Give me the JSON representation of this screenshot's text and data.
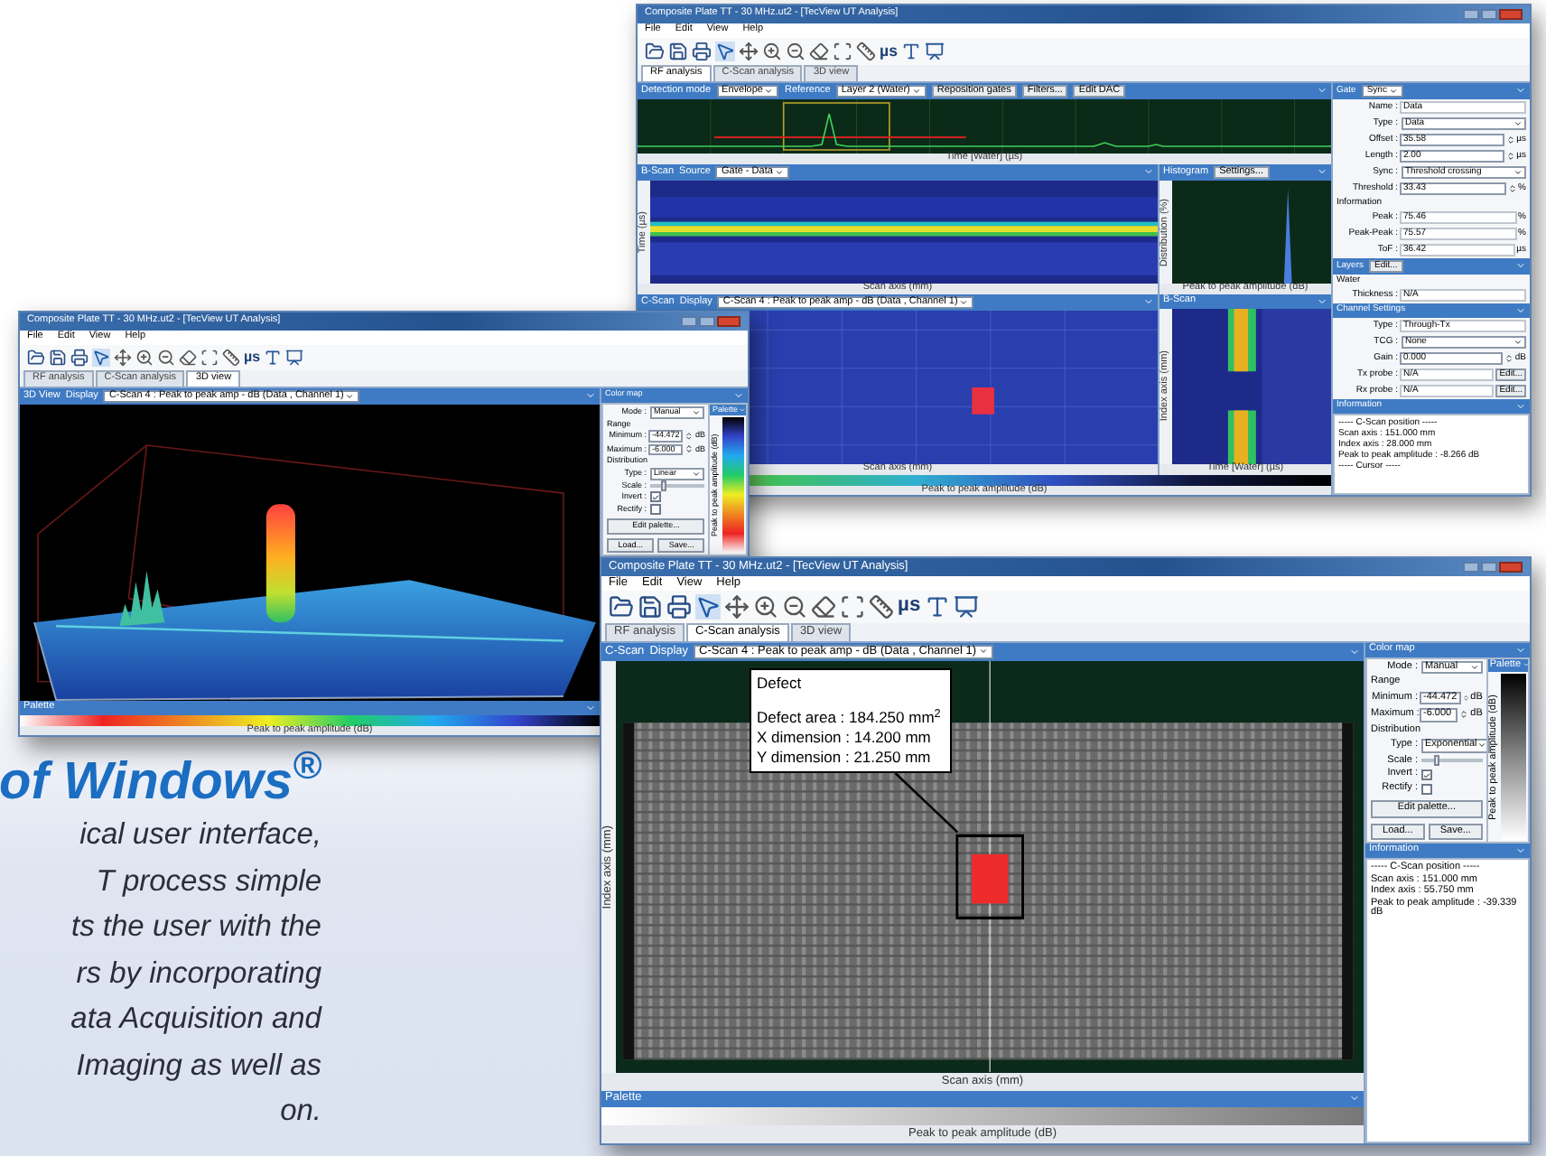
{
  "banner": {
    "heading": "of Windows$^{®}$",
    "lines": [
      "ical user interface,",
      "T process simple",
      "ts the user with the",
      "rs by incorporating",
      "ata Acquisition and",
      "Imaging as well as",
      "on."
    ]
  },
  "window_top": {
    "title": "Composite Plate TT - 30 MHz.ut2 - [TecView UT Analysis]",
    "menu": [
      "File",
      "Edit",
      "View",
      "Help"
    ],
    "toolbar_units": "µs",
    "tabs": [
      {
        "label": "RF analysis",
        "selected": true
      },
      {
        "label": "C-Scan analysis",
        "selected": false
      },
      {
        "label": "3D view",
        "selected": false
      }
    ],
    "ascan": {
      "header": [
        {
          "kind": "label",
          "text": "Detection mode"
        },
        {
          "kind": "select",
          "text": "Envelope"
        },
        {
          "kind": "label",
          "text": "Reference"
        },
        {
          "kind": "select",
          "text": "Layer 2 (Water)"
        },
        {
          "kind": "button",
          "text": "Reposition gates"
        },
        {
          "kind": "button",
          "text": "Filters..."
        },
        {
          "kind": "button",
          "text": "Edit DAC"
        }
      ],
      "xlabel": "Time [Water] (µs)"
    },
    "bscan": {
      "header": [
        {
          "kind": "label",
          "text": "B-Scan"
        },
        {
          "kind": "label",
          "text": "Source"
        },
        {
          "kind": "select",
          "text": "Gate - Data"
        }
      ],
      "xlabel": "Scan axis (mm)",
      "ylabel": "Time (µs)"
    },
    "histogram": {
      "header": [
        {
          "kind": "label",
          "text": "Histogram"
        },
        {
          "kind": "button",
          "text": "Settings..."
        }
      ],
      "xlabel": "Peak to peak amplitude (dB)",
      "ylabel": "Distribution (%)"
    },
    "cscan": {
      "header": [
        {
          "kind": "label",
          "text": "C-Scan"
        },
        {
          "kind": "label",
          "text": "Display"
        },
        {
          "kind": "select",
          "text": "C-Scan 4 : Peak to peak amp - dB (Data , Channel 1)"
        }
      ],
      "xlabel": "Scan axis (mm)"
    },
    "bscan2": {
      "header": [
        {
          "kind": "label",
          "text": "B-Scan"
        }
      ],
      "xlabel": "Time [Water] (µs)",
      "ylabel": "Index axis (mm)"
    },
    "palette": {
      "xlabel": "Peak to peak amplitude (dB)"
    },
    "gate": {
      "header": [
        {
          "kind": "label",
          "text": "Gate"
        },
        {
          "kind": "select",
          "text": "Sync"
        }
      ],
      "fields": [
        {
          "kind": "value",
          "label": "Name :",
          "value": "Data"
        },
        {
          "kind": "select",
          "label": "Type :",
          "value": "Data"
        },
        {
          "kind": "spin",
          "label": "Offset :",
          "value": "35.58",
          "unit": "µs"
        },
        {
          "kind": "spin",
          "label": "Length :",
          "value": "2.00",
          "unit": "µs"
        },
        {
          "kind": "select",
          "label": "Sync :",
          "value": "Threshold crossing"
        },
        {
          "kind": "spin",
          "label": "Threshold :",
          "value": "33.43",
          "unit": "%"
        },
        {
          "kind": "heading",
          "label": "Information"
        },
        {
          "kind": "value",
          "label": "Peak :",
          "value": "75.46",
          "unit": "%"
        },
        {
          "kind": "value",
          "label": "Peak-Peak :",
          "value": "75.57",
          "unit": "%"
        },
        {
          "kind": "value",
          "label": "ToF :",
          "value": "36.42",
          "unit": "µs"
        }
      ]
    },
    "layers": {
      "header": [
        {
          "kind": "label",
          "text": "Layers"
        },
        {
          "kind": "button",
          "text": "Edit..."
        }
      ],
      "fields": [
        {
          "kind": "heading",
          "label": "Water"
        },
        {
          "kind": "value",
          "label": "Thickness :",
          "value": "N/A"
        }
      ]
    },
    "channel": {
      "header": [
        {
          "kind": "label",
          "text": "Channel Settings"
        }
      ],
      "fields": [
        {
          "kind": "value",
          "label": "Type :",
          "value": "Through-Tx"
        },
        {
          "kind": "select",
          "label": "TCG :",
          "value": "None"
        },
        {
          "kind": "spin",
          "label": "Gain :",
          "value": "0.000",
          "unit": "dB"
        },
        {
          "kind": "edit",
          "label": "Tx probe :",
          "value": "N/A",
          "button": "Edit..."
        },
        {
          "kind": "edit",
          "label": "Rx probe :",
          "value": "N/A",
          "button": "Edit..."
        }
      ]
    },
    "information": {
      "title": "Information",
      "lines": [
        "----- C-Scan position -----",
        "Scan axis : 151.000 mm",
        "Index axis : 28.000 mm",
        "Peak to peak amplitude : -8.266 dB",
        "----- Cursor -----"
      ]
    }
  },
  "window_3d": {
    "title": "Composite Plate TT - 30 MHz.ut2 - [TecView UT Analysis]",
    "menu": [
      "File",
      "Edit",
      "View",
      "Help"
    ],
    "toolbar_units": "µs",
    "tabs": [
      {
        "label": "RF analysis",
        "selected": false
      },
      {
        "label": "C-Scan analysis",
        "selected": false
      },
      {
        "label": "3D view",
        "selected": true
      }
    ],
    "header": [
      {
        "kind": "label",
        "text": "3D View"
      },
      {
        "kind": "label",
        "text": "Display"
      },
      {
        "kind": "select",
        "text": "C-Scan 4 : Peak to peak amp - dB (Data , Channel 1)"
      }
    ],
    "color_map": {
      "title": "Color map",
      "fields": [
        {
          "kind": "select",
          "label": "Mode :",
          "value": "Manual"
        },
        {
          "kind": "heading",
          "label": "Range"
        },
        {
          "kind": "spin",
          "label": "Minimum :",
          "value": "-44.472",
          "unit": "dB"
        },
        {
          "kind": "spin",
          "label": "Maximum :",
          "value": "-6.000",
          "unit": "dB"
        },
        {
          "kind": "heading",
          "label": "Distribution"
        },
        {
          "kind": "select",
          "label": "Type :",
          "value": "Linear"
        },
        {
          "kind": "slider",
          "label": "Scale :",
          "level": 0.2
        },
        {
          "kind": "check",
          "label": "Invert :",
          "checked": true
        },
        {
          "kind": "check",
          "label": "Rectify :",
          "checked": false
        },
        {
          "kind": "buttons",
          "buttons": [
            "Edit palette..."
          ]
        },
        {
          "kind": "buttons",
          "buttons": [
            "Load...",
            "Save..."
          ]
        }
      ],
      "palette_title": "Palette",
      "palette_label": "Peak to peak amplitude (dB)"
    },
    "palette": {
      "title": "Palette",
      "xlabel": "Peak to peak amplitude (dB)"
    }
  },
  "window_cscan": {
    "title": "Composite Plate TT - 30 MHz.ut2 - [TecView UT Analysis]",
    "menu": [
      "File",
      "Edit",
      "View",
      "Help"
    ],
    "toolbar_units": "µs",
    "tabs": [
      {
        "label": "RF analysis",
        "selected": false
      },
      {
        "label": "C-Scan analysis",
        "selected": true
      },
      {
        "label": "3D view",
        "selected": false
      }
    ],
    "header": [
      {
        "kind": "label",
        "text": "C-Scan"
      },
      {
        "kind": "label",
        "text": "Display"
      },
      {
        "kind": "select",
        "text": "C-Scan 4 : Peak to peak amp - dB (Data , Channel 1)"
      }
    ],
    "callout": {
      "title": "Defect",
      "lines": [
        "Defect area : 184.250 mm$^{2}$",
        "X dimension : 14.200 mm",
        "Y dimension : 21.250 mm"
      ]
    },
    "xlabel": "Scan axis (mm)",
    "ylabel": "Index axis (mm)",
    "color_map": {
      "title": "Color map",
      "fields": [
        {
          "kind": "select",
          "label": "Mode :",
          "value": "Manual"
        },
        {
          "kind": "heading",
          "label": "Range"
        },
        {
          "kind": "spin",
          "label": "Minimum :",
          "value": "-44.472",
          "unit": "dB"
        },
        {
          "kind": "spin",
          "label": "Maximum :",
          "value": "-6.000",
          "unit": "dB"
        },
        {
          "kind": "heading",
          "label": "Distribution"
        },
        {
          "kind": "select",
          "label": "Type :",
          "value": "Exponential"
        },
        {
          "kind": "slider",
          "label": "Scale :",
          "level": 0.2
        },
        {
          "kind": "check",
          "label": "Invert :",
          "checked": true
        },
        {
          "kind": "check",
          "label": "Rectify :",
          "checked": false
        },
        {
          "kind": "buttons",
          "buttons": [
            "Edit palette..."
          ]
        },
        {
          "kind": "buttons",
          "buttons": [
            "Load...",
            "Save..."
          ]
        }
      ],
      "palette_title": "Palette",
      "palette_label": "Peak to peak amplitude (dB)"
    },
    "information": {
      "title": "Information",
      "lines": [
        "----- C-Scan position -----",
        "Scan axis : 151.000 mm",
        "Index axis : 55.750 mm",
        "Peak to peak amplitude : -39.339 dB"
      ]
    },
    "palette": {
      "title": "Palette",
      "xlabel": "Peak to peak amplitude (dB)"
    }
  }
}
